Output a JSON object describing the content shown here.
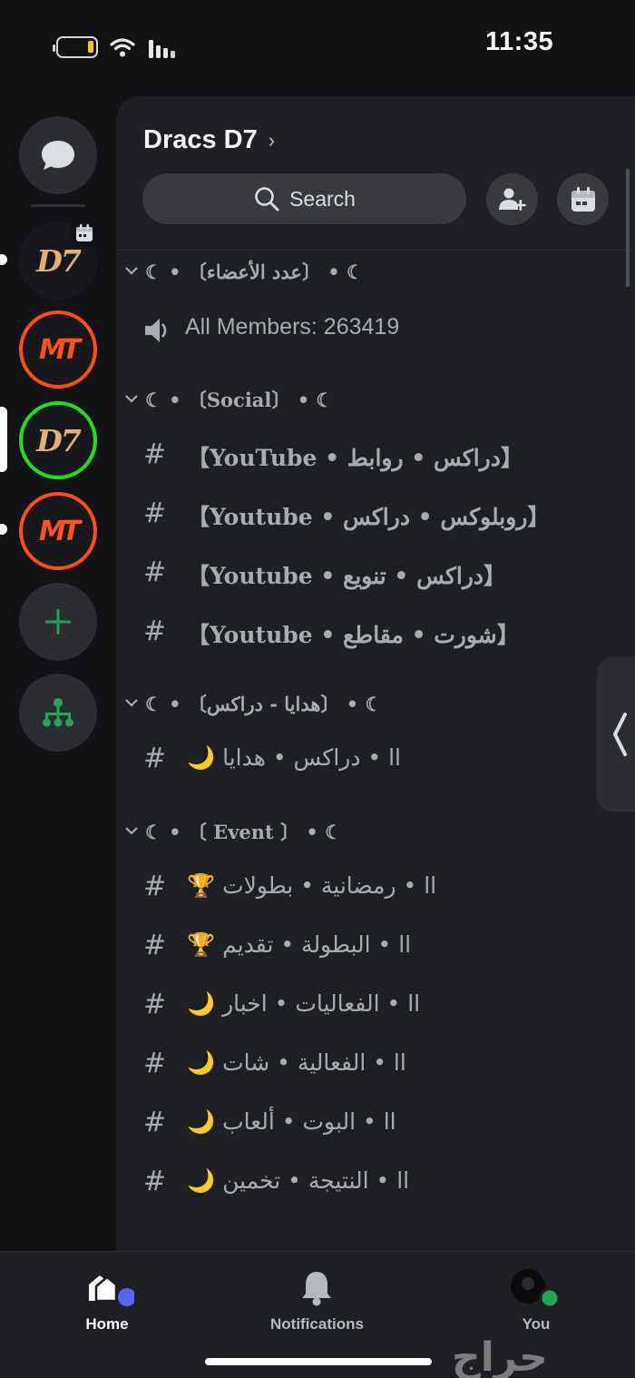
{
  "status_bar": {
    "time": "11:35"
  },
  "server": {
    "name": "Dracs D7",
    "chevron": "›",
    "search_label": "Search",
    "invite_icon": "add-member-icon",
    "events_icon": "calendar-icon"
  },
  "rail": {
    "servers": [
      {
        "name": "dm",
        "icon": "chat-bubble-icon"
      },
      {
        "name": "Dracs D7",
        "logo_text": "D7"
      },
      {
        "name": "MT",
        "logo_text": "MT"
      },
      {
        "name": "Dracs D7 active",
        "logo_text": "D7"
      },
      {
        "name": "MT 2",
        "logo_text": "MT"
      }
    ],
    "add_icon": "plus-icon",
    "discover_icon": "hierarchy-icon"
  },
  "channels": {
    "members_category": "☾ • 〔عدد الأعضاء〕 • ☾",
    "members_label": "All Members: 263419",
    "social_category": "☾ • 〔Social〕 • ☾",
    "social_channels": [
      "【YouTube • دراكس • روابط】",
      "【Youtube • روبلوكس • دراكس】",
      "【Youtube • دراكس • تنويع】",
      "【Youtube • شورت • مقاطع】"
    ],
    "gifts_category": "☾ • 〔هدايا - دراكس〕 • ☾",
    "gifts_channels": [
      "🌙 اا • دراكس • هدايا"
    ],
    "event_category": "☾ • 〔 Event 〕 • ☾",
    "event_channels": [
      "🏆 اا • رمضانية • بطولات",
      "🏆 اا • البطولة • تقديم",
      "🌙 اا • الفعاليات • اخبار",
      "🌙 اا • الفعالية • شات",
      "🌙 اا • البوت • ألعاب",
      "🌙 اا • النتيجة • تخمين"
    ]
  },
  "bottom_nav": {
    "home": "Home",
    "notifications": "Notifications",
    "you": "You"
  },
  "watermark": "حراج",
  "colors": {
    "accent": "#5865f2",
    "online": "#23a55a",
    "background": "#111214",
    "panel": "#1e1f22"
  }
}
